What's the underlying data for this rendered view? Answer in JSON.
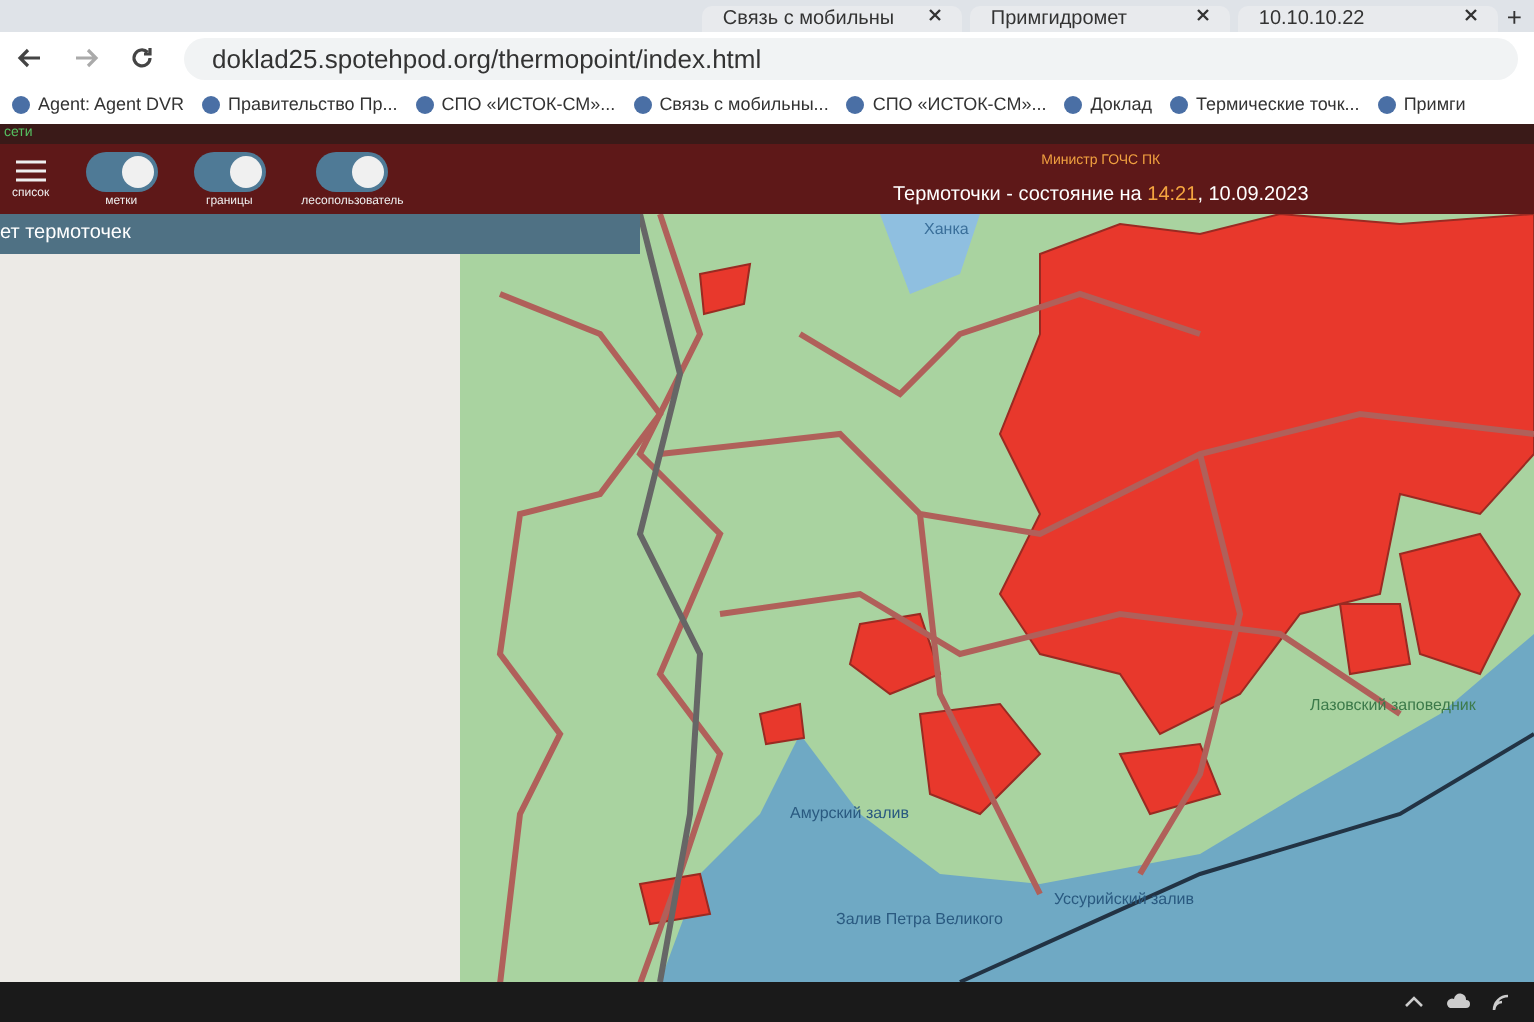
{
  "browser": {
    "tabs": [
      {
        "label": "Связь с мобильны",
        "selected": false
      },
      {
        "label": "Примгидромет",
        "selected": false
      },
      {
        "label": "10.10.10.22",
        "selected": false
      }
    ],
    "new_tab": "+",
    "address": "doklad25.spotehpod.org/thermopoint/index.html",
    "bookmarks": [
      "Agent: Agent DVR",
      "Правительство Пр...",
      "СПО «ИСТОК-СМ»...",
      "Связь с мобильны...",
      "СПО «ИСТОК-СМ»...",
      "Доклад",
      "Термические точк...",
      "Примги"
    ]
  },
  "app": {
    "status": "сети",
    "menu_label": "список",
    "toggles": [
      {
        "label": "метки",
        "on": true
      },
      {
        "label": "границы",
        "on": true
      },
      {
        "label": "лесопользователь",
        "on": true
      }
    ],
    "subtitle": "Министр ГОЧС ПК",
    "title_prefix": "Термоточки - состояние на ",
    "time": "14:21",
    "date": ", 10.09.2023",
    "panel_title": "ет термоточек"
  },
  "map": {
    "labels": [
      {
        "text": "Ханка",
        "kind": "lake"
      },
      {
        "text": "Лазовский заповедник",
        "kind": "land"
      },
      {
        "text": "Амурский залив",
        "kind": "sea"
      },
      {
        "text": "Уссурийский залив",
        "kind": "sea"
      },
      {
        "text": "Залив Петра Великого",
        "kind": "sea"
      }
    ]
  }
}
